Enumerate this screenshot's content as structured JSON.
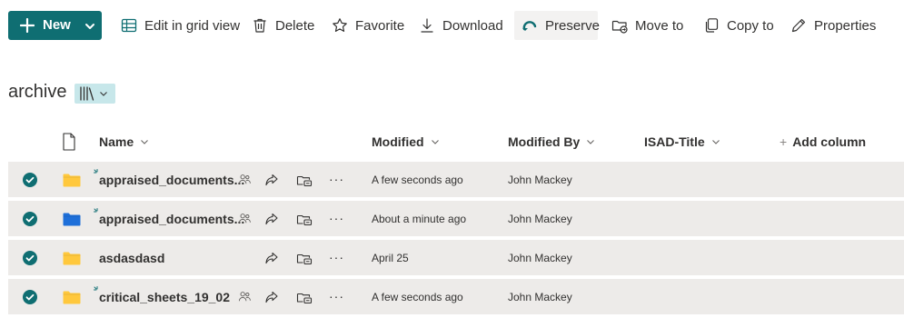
{
  "command_bar": {
    "new_label": "New",
    "items": [
      {
        "label": "Edit in grid view",
        "icon": "grid-icon"
      },
      {
        "label": "Delete",
        "icon": "trash-icon"
      },
      {
        "label": "Favorite",
        "icon": "star-icon"
      },
      {
        "label": "Download",
        "icon": "download-icon"
      },
      {
        "label": "Preserve",
        "icon": "preserve-icon"
      },
      {
        "label": "Move to",
        "icon": "move-folder-icon"
      },
      {
        "label": "Copy to",
        "icon": "copy-icon"
      },
      {
        "label": "Properties",
        "icon": "pencil-icon"
      }
    ]
  },
  "library": {
    "title": "archive",
    "view_icon": "library-books-icon"
  },
  "columns": {
    "name": "Name",
    "modified": "Modified",
    "modified_by": "Modified By",
    "isad_title": "ISAD-Title",
    "add_column": "Add column",
    "add_column_plus": "+"
  },
  "rows": [
    {
      "name": "appraised_documents...",
      "folder_color": "#ffc83d",
      "modified": "A few seconds ago",
      "modified_by": "John Mackey",
      "new": true,
      "shared": true
    },
    {
      "name": "appraised_documents...",
      "folder_color": "#1e6fd9",
      "modified": "About a minute ago",
      "modified_by": "John Mackey",
      "new": true,
      "shared": true
    },
    {
      "name": "asdasdasd",
      "folder_color": "#ffc83d",
      "modified": "April 25",
      "modified_by": "John Mackey",
      "new": false,
      "shared": false
    },
    {
      "name": "critical_sheets_19_02",
      "folder_color": "#ffc83d",
      "modified": "A few seconds ago",
      "modified_by": "John Mackey",
      "new": true,
      "shared": true
    }
  ],
  "row_more_label": "···",
  "colors": {
    "accent": "#0f6e72",
    "selected_row": "#edebe9",
    "view_switch": "#c7e7ea"
  }
}
